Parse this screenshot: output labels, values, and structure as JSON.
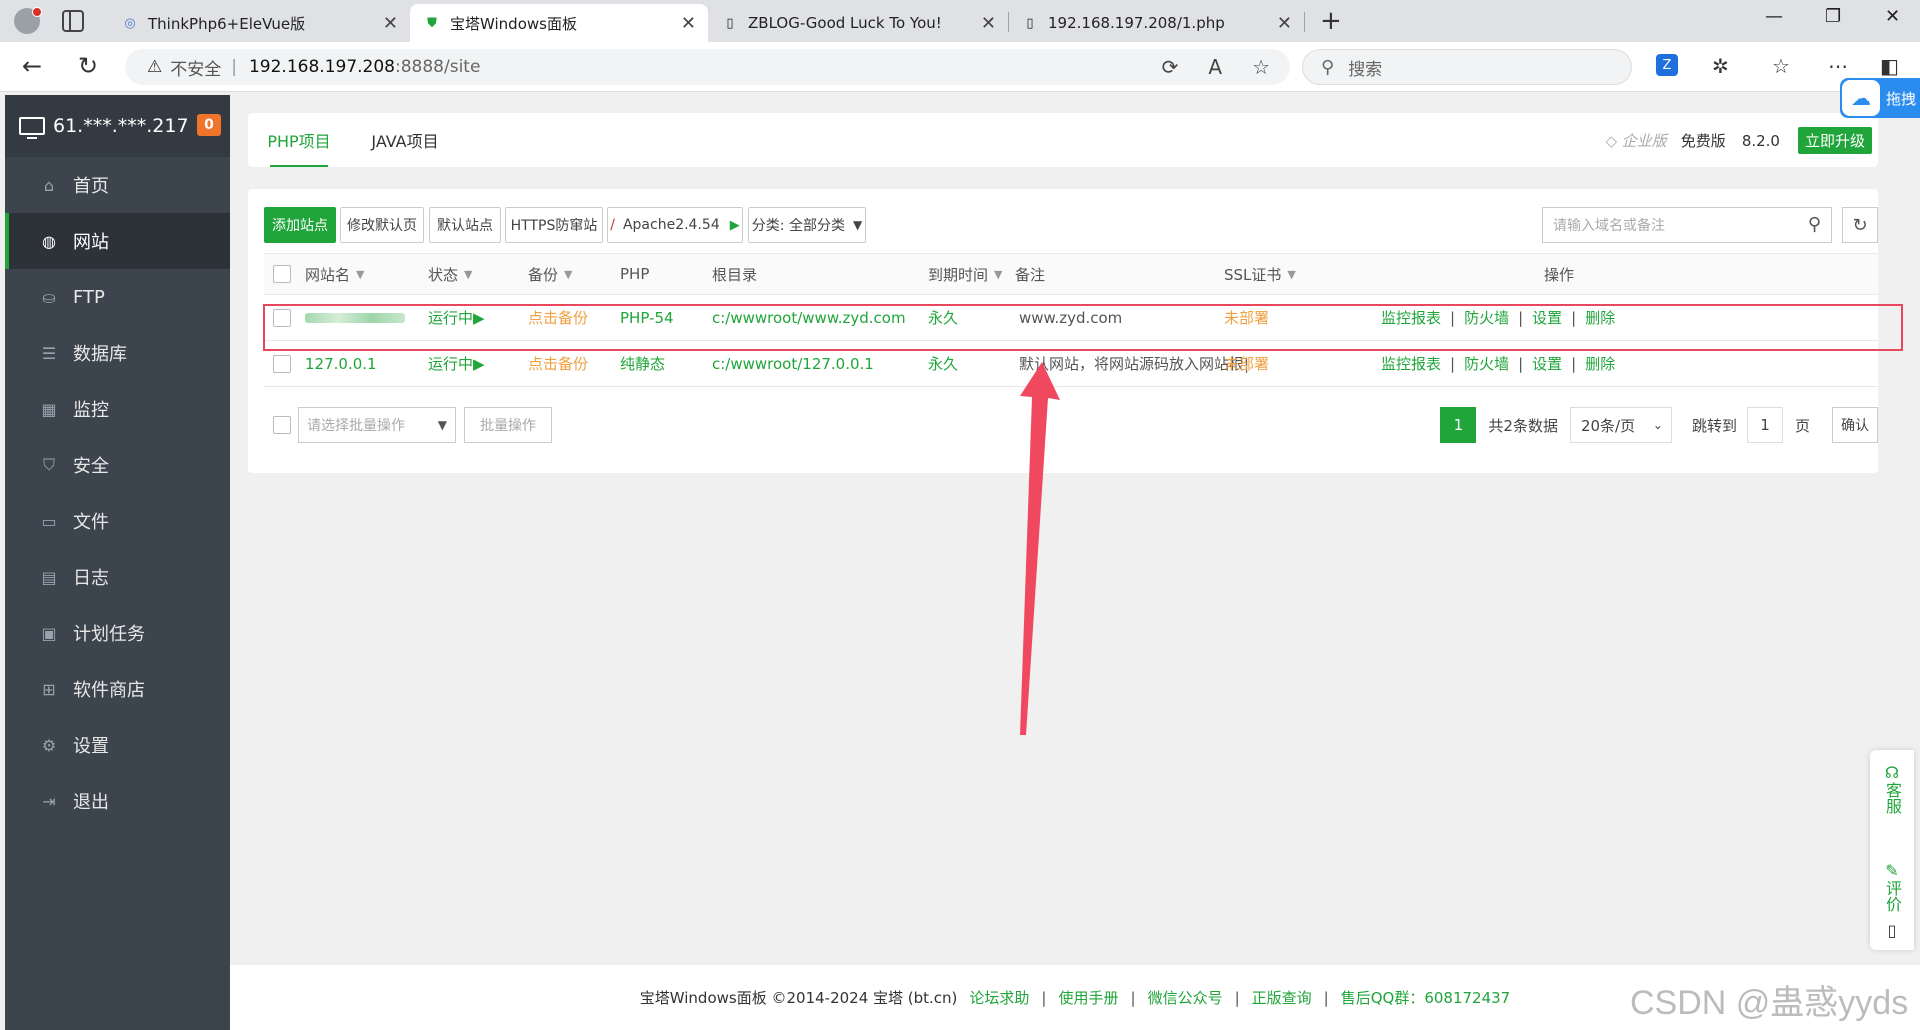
{
  "browser": {
    "tabs": [
      {
        "title": "ThinkPhp6+EleVue版"
      },
      {
        "title": "宝塔Windows面板"
      },
      {
        "title": "ZBLOG-Good Luck To You!"
      },
      {
        "title": "192.168.197.208/1.php"
      }
    ],
    "url": {
      "insecure_label": "不安全",
      "host": "192.168.197.208",
      "path": ":8888/site"
    },
    "search_placeholder": "搜索",
    "cloud_label": "拖拽"
  },
  "sidebar": {
    "server": "61.***.***.217",
    "badge": "0",
    "items": [
      {
        "label": "首页",
        "icon": "home-icon"
      },
      {
        "label": "网站",
        "icon": "globe-icon"
      },
      {
        "label": "FTP",
        "icon": "ftp-icon"
      },
      {
        "label": "数据库",
        "icon": "database-icon"
      },
      {
        "label": "监控",
        "icon": "monitor-icon"
      },
      {
        "label": "安全",
        "icon": "shield-icon"
      },
      {
        "label": "文件",
        "icon": "folder-icon"
      },
      {
        "label": "日志",
        "icon": "log-icon"
      },
      {
        "label": "计划任务",
        "icon": "calendar-icon"
      },
      {
        "label": "软件商店",
        "icon": "apps-icon"
      },
      {
        "label": "设置",
        "icon": "gear-icon"
      },
      {
        "label": "退出",
        "icon": "logout-icon"
      }
    ]
  },
  "top": {
    "tabs": [
      "PHP项目",
      "JAVA项目"
    ],
    "enterprise": "企业版",
    "free": "免费版",
    "version": "8.2.0",
    "upgrade": "立即升级"
  },
  "toolbar": {
    "add_site": "添加站点",
    "edit_default_page": "修改默认页",
    "default_site": "默认站点",
    "https_guard": "HTTPS防窜站",
    "apache": "Apache2.4.54",
    "category": "分类: 全部分类",
    "search_placeholder": "请输入域名或备注"
  },
  "table": {
    "headers": {
      "name": "网站名",
      "status": "状态",
      "backup": "备份",
      "php": "PHP",
      "root": "根目录",
      "expire": "到期时间",
      "remark": "备注",
      "ssl": "SSL证书",
      "ops": "操作"
    },
    "rows": [
      {
        "name": "",
        "status": "运行中",
        "backup": "点击备份",
        "php": "PHP-54",
        "root": "c:/wwwroot/www.zyd.com",
        "expire": "永久",
        "remark": "www.zyd.com",
        "ssl": "未部署"
      },
      {
        "name": "127.0.0.1",
        "status": "运行中",
        "backup": "点击备份",
        "php": "纯静态",
        "root": "c:/wwwroot/127.0.0.1",
        "expire": "永久",
        "remark": "默认网站，将网站源码放入网站根|",
        "ssl": "未部署"
      }
    ],
    "ops": [
      "监控报表",
      "防火墙",
      "设置",
      "删除"
    ]
  },
  "batch": {
    "placeholder": "请选择批量操作",
    "button": "批量操作"
  },
  "pager": {
    "current": "1",
    "total": "共2条数据",
    "page_size": "20条/页",
    "jump_label": "跳转到",
    "page_input": "1",
    "page_unit": "页",
    "confirm": "确认"
  },
  "footer": {
    "copyright": "宝塔Windows面板 ©2014-2024 宝塔 (bt.cn)",
    "links": [
      "论坛求助",
      "使用手册",
      "微信公众号",
      "正版查询",
      "售后QQ群：608172437"
    ]
  },
  "float": {
    "service": "客服",
    "review": "评价"
  },
  "watermark": "CSDN @蛊惑yyds",
  "colors": {
    "accent": "#20a53a",
    "warning": "#f0a040",
    "highlight": "#e8485d"
  }
}
